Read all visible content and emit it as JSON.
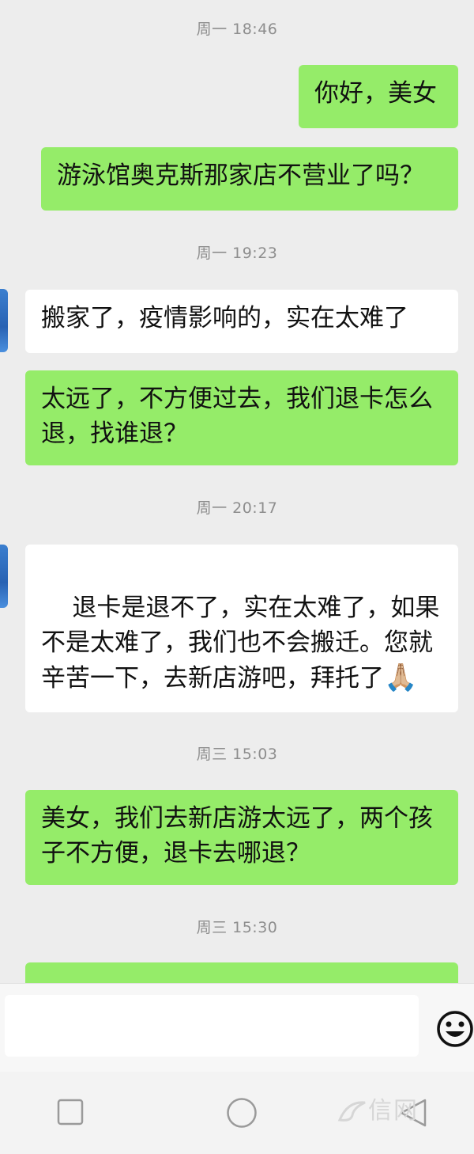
{
  "messages": [
    {
      "type": "time",
      "text": "周一 18:46"
    },
    {
      "type": "me",
      "text": "你好，美女"
    },
    {
      "type": "me",
      "text": "游泳馆奥克斯那家店不营业了吗？"
    },
    {
      "type": "time",
      "text": "周一 19:23"
    },
    {
      "type": "other",
      "text": "搬家了，疫情影响的，实在太难了"
    },
    {
      "type": "me",
      "text": "太远了，不方便过去，我们退卡怎么退，找谁退？"
    },
    {
      "type": "time",
      "text": "周一 20:17"
    },
    {
      "type": "other",
      "text": "退卡是退不了，实在太难了，如果不是太难了，我们也不会搬迁。您就辛苦一下，去新店游吧，拜托了",
      "emoji": "🙏🏼"
    },
    {
      "type": "time",
      "text": "周三 15:03"
    },
    {
      "type": "me",
      "text": "美女，我们去新店游太远了，两个孩子不方便，退卡去哪退？"
    },
    {
      "type": "time",
      "text": "周三 15:30"
    }
  ],
  "input": {
    "placeholder": "",
    "emoji_button_icon": "smile-icon"
  },
  "nav": {
    "back_icon": "back-triangle-icon",
    "home_icon": "home-circle-icon",
    "recent_icon": "recent-square-icon"
  },
  "watermark": {
    "text": "信网"
  },
  "colors": {
    "my_bubble": "#95ec69",
    "other_bubble": "#ffffff",
    "background": "#ededed"
  }
}
